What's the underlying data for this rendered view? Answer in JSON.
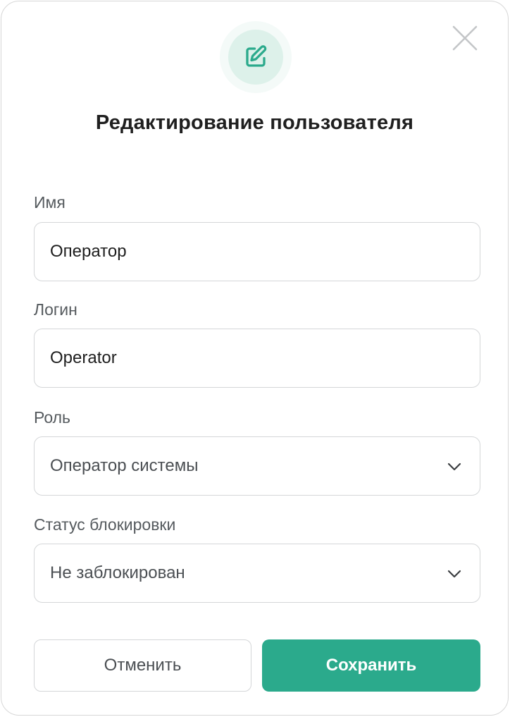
{
  "dialog": {
    "title": "Редактирование пользователя",
    "icon": "edit-icon",
    "close_icon": "close-icon",
    "accent_color": "#2baa8c"
  },
  "form": {
    "name": {
      "label": "Имя",
      "value": "Оператор"
    },
    "login": {
      "label": "Логин",
      "value": "Operator"
    },
    "role": {
      "label": "Роль",
      "value": "Оператор системы",
      "icon": "chevron-down-icon"
    },
    "block_status": {
      "label": "Статус блокировки",
      "value": "Не заблокирован",
      "icon": "chevron-down-icon"
    }
  },
  "actions": {
    "cancel_label": "Отменить",
    "save_label": "Сохранить"
  }
}
